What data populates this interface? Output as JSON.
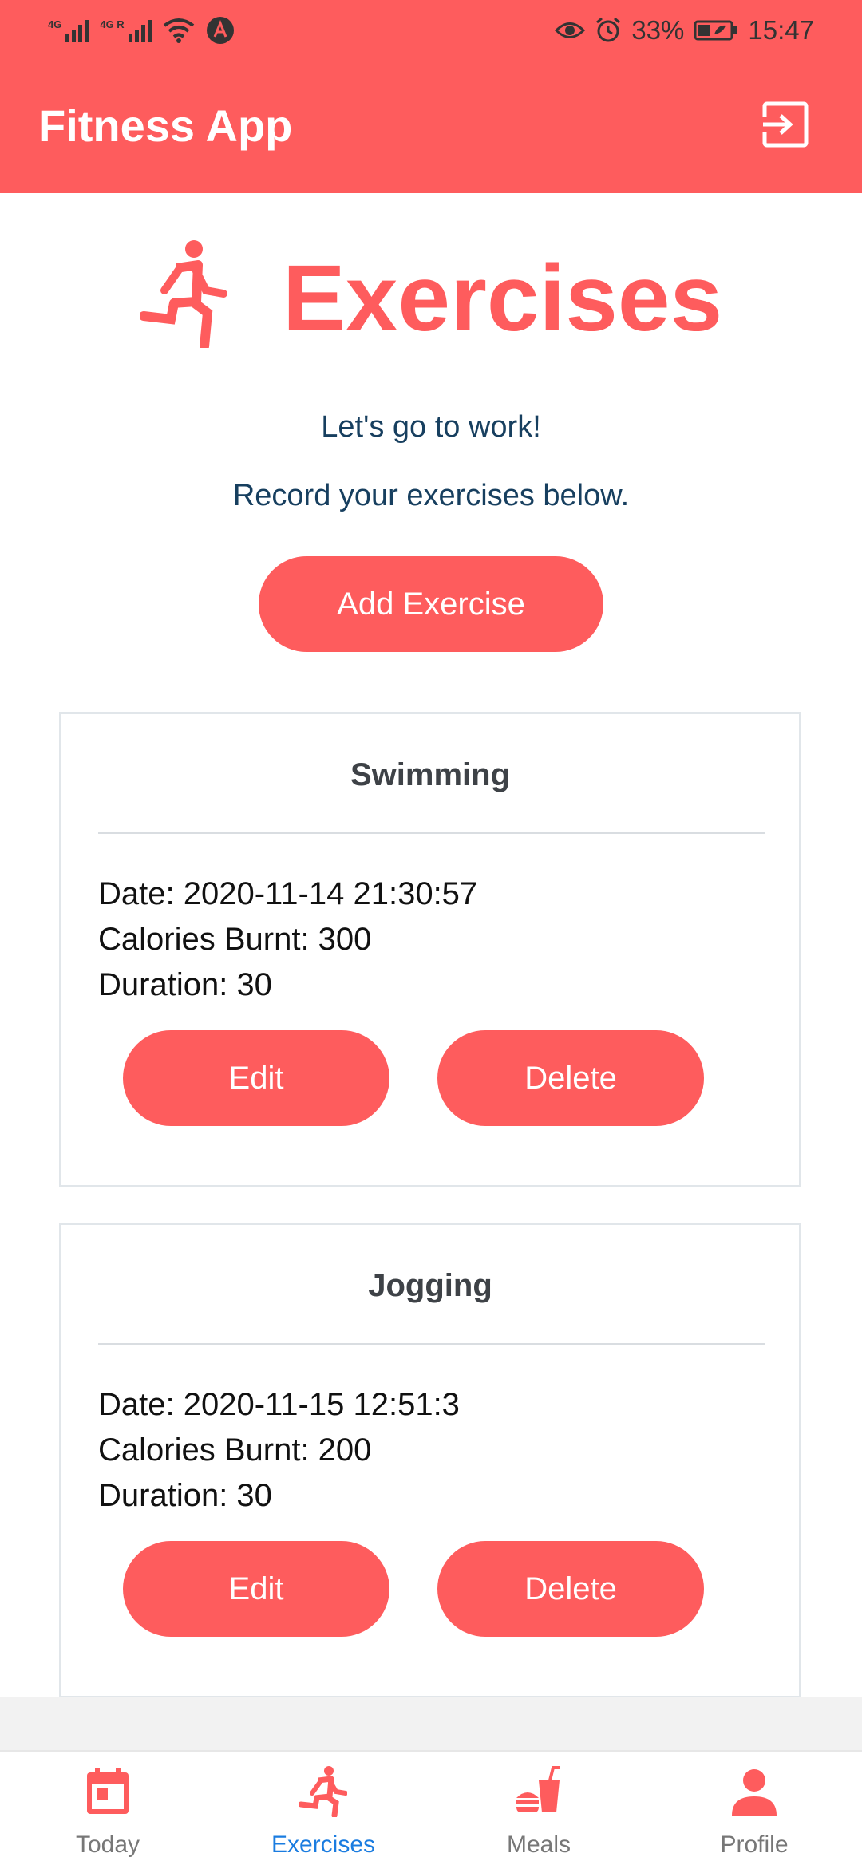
{
  "status_bar": {
    "network_1": "4G",
    "network_2": "4G R",
    "battery": "33%",
    "time": "15:47"
  },
  "app_bar": {
    "title": "Fitness App",
    "logout_icon": "logout-icon",
    "color": "#fe5c5d"
  },
  "hero": {
    "icon": "running-person-icon",
    "title": "Exercises",
    "line1": "Let's go to work!",
    "line2": "Record your exercises below."
  },
  "add_button": {
    "label": "Add Exercise"
  },
  "exercises": [
    {
      "name": "Swimming",
      "date": "Date: 2020-11-14 21:30:57",
      "calories": "Calories Burnt: 300",
      "duration": "Duration: 30",
      "edit_label": "Edit",
      "delete_label": "Delete"
    },
    {
      "name": "Jogging",
      "date": "Date: 2020-11-15 12:51:3",
      "calories": "Calories Burnt: 200",
      "duration": "Duration: 30",
      "edit_label": "Edit",
      "delete_label": "Delete"
    }
  ],
  "bottom_nav": {
    "items": [
      {
        "label": "Today",
        "icon": "calendar-icon"
      },
      {
        "label": "Exercises",
        "icon": "running-person-icon",
        "active": true
      },
      {
        "label": "Meals",
        "icon": "fastfood-icon"
      },
      {
        "label": "Profile",
        "icon": "person-icon"
      }
    ],
    "active_color": "#1a7ce0"
  }
}
